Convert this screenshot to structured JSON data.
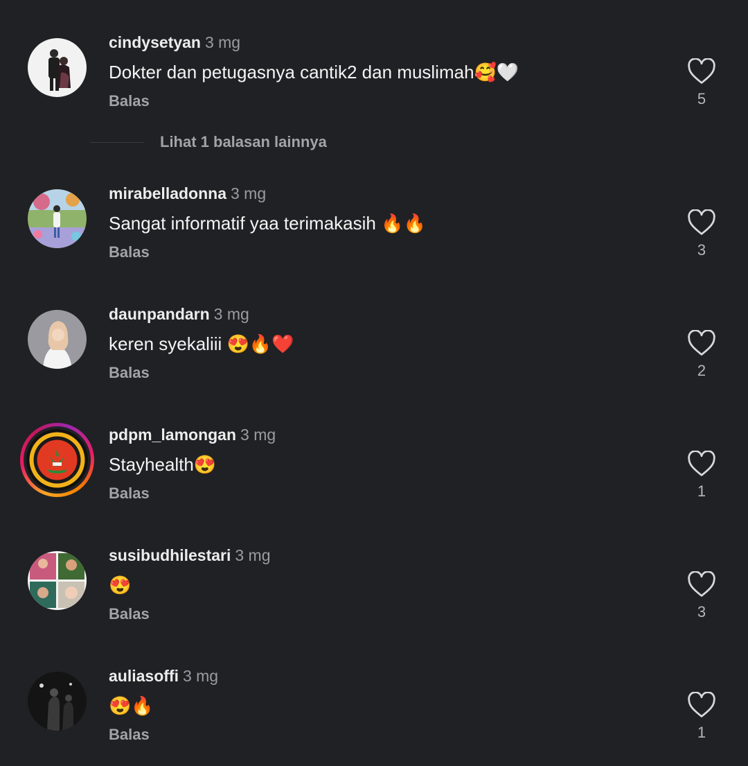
{
  "comments": [
    {
      "username": "cindysetyan",
      "time": "3 mg",
      "text": "Dokter dan petugasnya cantik2 dan muslimah🥰🤍",
      "reply_label": "Balas",
      "likes": "5"
    },
    {
      "username": "mirabelladonna",
      "time": "3 mg",
      "text": "Sangat informatif yaa terimakasih 🔥🔥",
      "reply_label": "Balas",
      "likes": "3"
    },
    {
      "username": "daunpandarn",
      "time": "3 mg",
      "text": "keren syekaliii 😍🔥❤️",
      "reply_label": "Balas",
      "likes": "2"
    },
    {
      "username": "pdpm_lamongan",
      "time": "3 mg",
      "text": "Stayhealth😍",
      "reply_label": "Balas",
      "likes": "1"
    },
    {
      "username": "susibudhilestari",
      "time": "3 mg",
      "text": "😍",
      "reply_label": "Balas",
      "likes": "3"
    },
    {
      "username": "auliasoffi",
      "time": "3 mg",
      "text": "😍🔥",
      "reply_label": "Balas",
      "likes": "1"
    }
  ],
  "view_more_replies": "Lihat 1 balasan lainnya",
  "icons": {
    "like": "heart-outline-icon"
  },
  "colors": {
    "background": "#202124",
    "username": "#ededed",
    "secondary_text": "#9b9ca1",
    "story_ring_start": "#f9a825",
    "story_ring_end": "#9c27b0"
  }
}
